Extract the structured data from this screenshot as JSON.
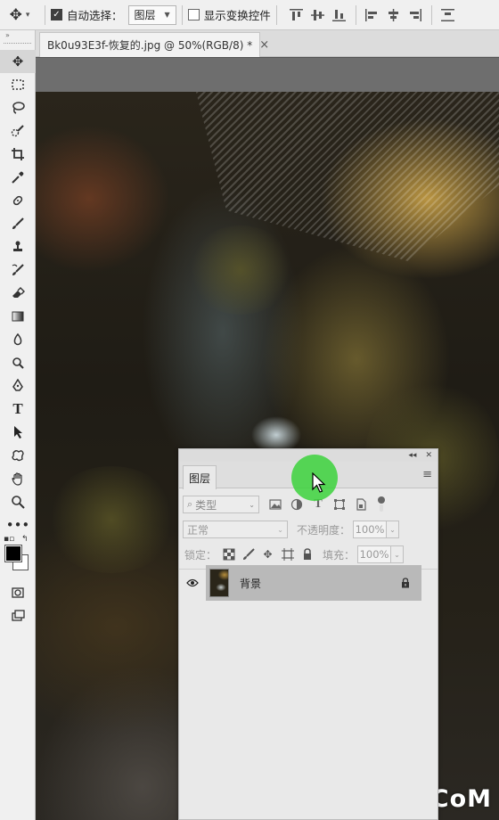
{
  "options_bar": {
    "auto_select_label": "自动选择：",
    "auto_select_checked": true,
    "auto_select_target": "图层",
    "show_transform_label": "显示变换控件",
    "show_transform_checked": false,
    "icons": [
      "move-tool-icon",
      "align-top-icon",
      "align-vertical-center-icon",
      "align-bottom-icon",
      "align-left-icon",
      "align-horizontal-center-icon",
      "align-right-icon",
      "distribute-icon"
    ]
  },
  "document_tab": {
    "title": "Bk0u93E3f-恢复的.jpg @ 50%(RGB/8) *",
    "close": "×"
  },
  "toolbar": {
    "collapse": "»",
    "tools": [
      "move",
      "marquee",
      "lasso",
      "quick-selection",
      "crop",
      "eyedropper",
      "healing-brush",
      "brush",
      "clone-stamp",
      "history-brush",
      "eraser",
      "gradient",
      "blur",
      "dodge",
      "pen",
      "type",
      "path-selection",
      "shape",
      "hand",
      "zoom",
      "more"
    ],
    "foreground_color": "#000000",
    "background_color": "#ffffff"
  },
  "layers_panel": {
    "tab_label": "图层",
    "filter_kind": "类型",
    "blend_mode": "正常",
    "opacity_label": "不透明度：",
    "opacity_value": "100%",
    "lock_label": "锁定：",
    "fill_label": "填充：",
    "fill_value": "100%",
    "layers": [
      {
        "name": "背景",
        "visible": true,
        "locked": true,
        "selected": true
      }
    ]
  },
  "watermark": "UiBQ.CoM",
  "accent_colors": {
    "cursor_highlight": "#3cd23c",
    "selected_layer": "#b9b9b9"
  }
}
